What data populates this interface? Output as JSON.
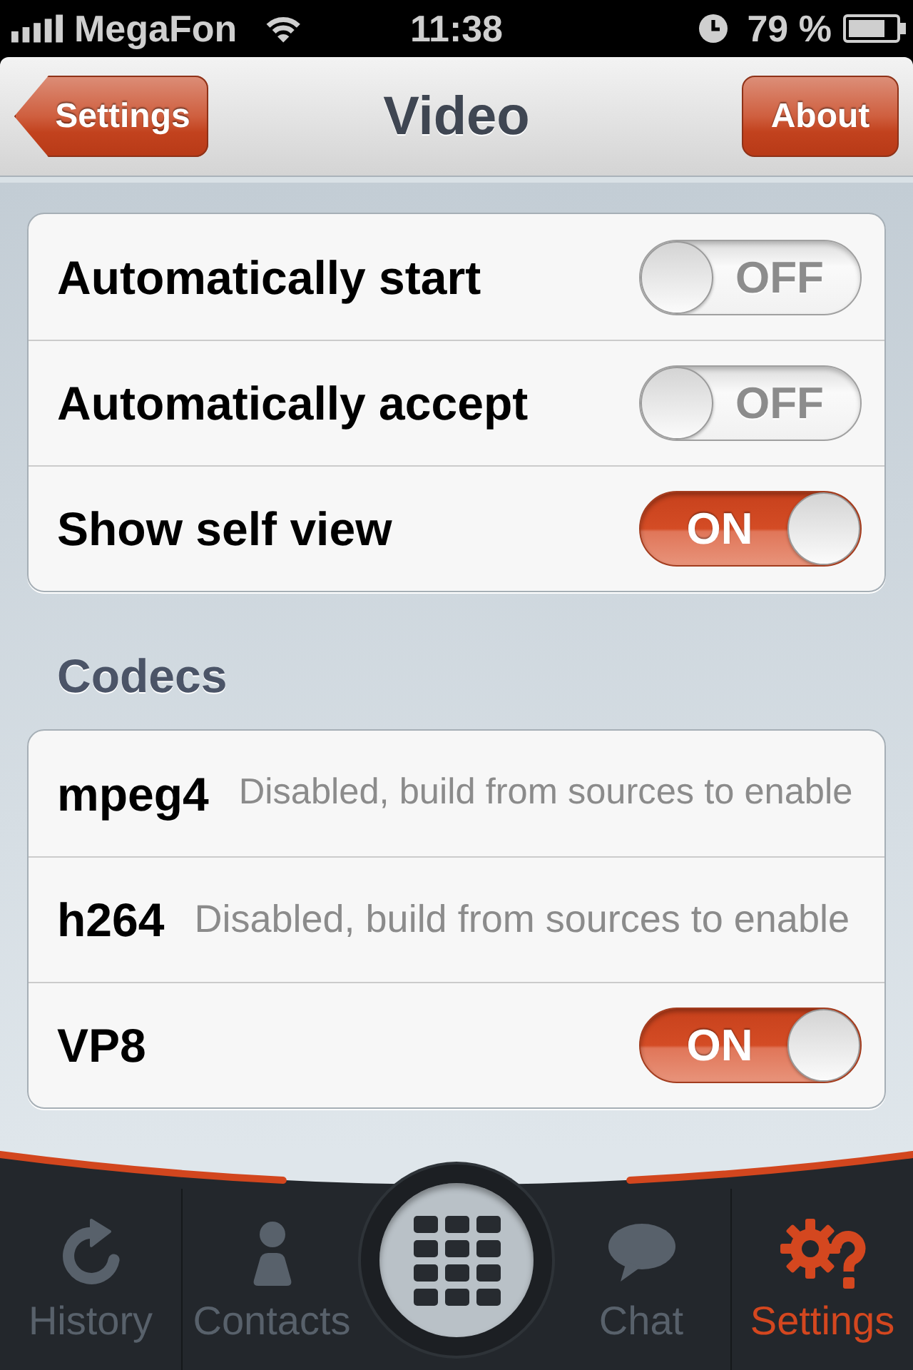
{
  "status_bar": {
    "carrier": "MegaFon",
    "time": "11:38",
    "battery": "79 %"
  },
  "nav_bar": {
    "back_button": "Settings",
    "title": "Video",
    "right_button": "About"
  },
  "video_options": [
    {
      "label": "Automatically start",
      "on": false,
      "switch_text": "OFF"
    },
    {
      "label": "Automatically accept",
      "on": false,
      "switch_text": "OFF"
    },
    {
      "label": "Show self view",
      "on": true,
      "switch_text": "ON"
    }
  ],
  "codecs": {
    "header": "Codecs",
    "rows": [
      {
        "kind": "note",
        "name": "mpeg4",
        "note": "Disabled, build from sources to enable"
      },
      {
        "kind": "note",
        "name": "h264",
        "note": "Disabled, build from sources to enable"
      },
      {
        "kind": "switch",
        "name": "VP8",
        "on": true,
        "switch_text": "ON"
      }
    ]
  },
  "tab_bar": [
    {
      "kind": "tab",
      "label": "History",
      "selected": false
    },
    {
      "kind": "tab",
      "label": "Contacts",
      "selected": false
    },
    {
      "kind": "dialpad",
      "selected": false
    },
    {
      "kind": "tab",
      "label": "Chat",
      "selected": false
    },
    {
      "kind": "tab",
      "label": "Settings",
      "selected": true
    }
  ]
}
